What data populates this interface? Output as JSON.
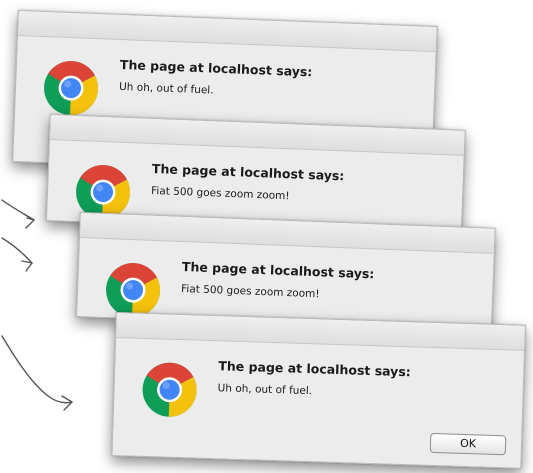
{
  "dialogs": [
    {
      "title": "The page at localhost says:",
      "message": "Uh oh, out of fuel."
    },
    {
      "title": "The page at localhost says:",
      "message": "Fiat 500 goes zoom zoom!"
    },
    {
      "title": "The page at localhost says:",
      "message": "Fiat 500 goes zoom zoom!"
    },
    {
      "title": "The page at localhost says:",
      "message": "Uh oh, out of fuel.",
      "button_label": "OK"
    }
  ],
  "icon": "chrome-browser-icon",
  "colors": {
    "chrome_red": "#db4437",
    "chrome_yellow": "#f4c20d",
    "chrome_green": "#0f9d58",
    "chrome_blue": "#4285f4",
    "dialog_bg": "#ececec",
    "annotation_stroke": "#555555"
  }
}
